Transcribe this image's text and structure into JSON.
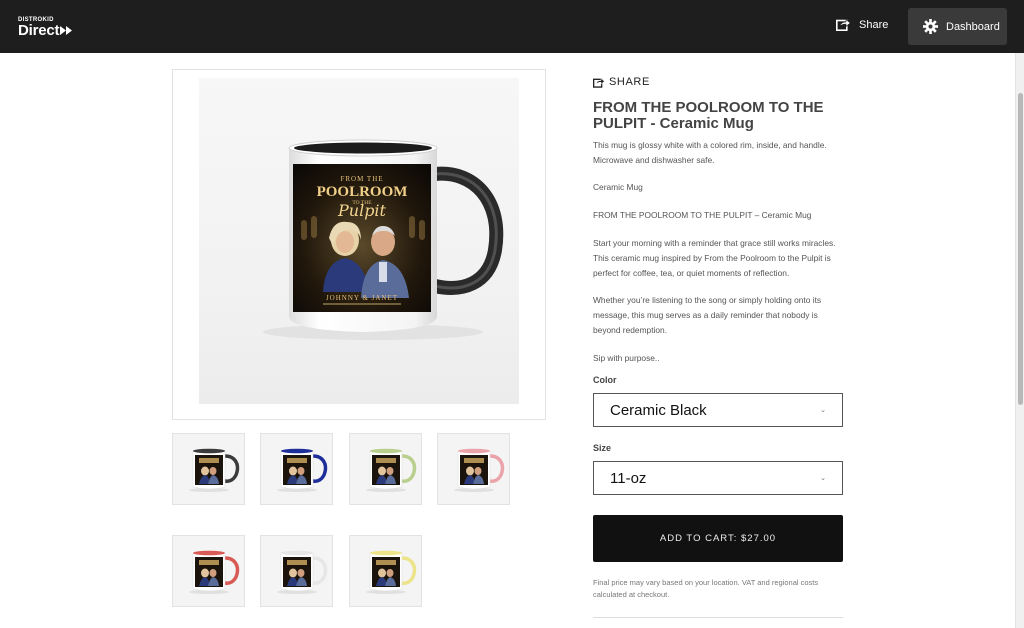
{
  "header": {
    "logo_small": "DISTROKID",
    "logo_main": "Direct",
    "share_label": "Share",
    "dashboard_label": "Dashboard"
  },
  "mug_art": {
    "line1": "FROM THE",
    "line2": "POOLROOM",
    "line3": "TO THE",
    "line4": "Pulpit",
    "artists": "JOHNNY & JANET"
  },
  "product": {
    "share_label": "SHARE",
    "title": "FROM THE POOLROOM TO THE PULPIT - Ceramic Mug",
    "paragraphs": [
      "This mug is glossy white with a colored rim, inside, and handle. Microwave and dishwasher safe.",
      "Ceramic Mug",
      "FROM THE POOLROOM TO THE PULPIT – Ceramic Mug",
      "Start your morning with a reminder that grace still works miracles. This ceramic mug inspired by From the Poolroom to the Pulpit is perfect for coffee, tea, or quiet moments of reflection.",
      "Whether you’re listening to the song or simply holding onto its message, this mug serves as a daily reminder that nobody is beyond redemption.",
      "Sip with purpose.."
    ],
    "color_label": "Color",
    "color_value": "Ceramic Black",
    "size_label": "Size",
    "size_value": "11-oz",
    "cart_label": "ADD TO CART: $27.00",
    "note": "Final price may vary based on your location. VAT and regional costs calculated at checkout."
  },
  "thumbnails": [
    {
      "name": "thumb-black",
      "color": "#3b3b3b"
    },
    {
      "name": "thumb-blue",
      "color": "#1f2f9a"
    },
    {
      "name": "thumb-green",
      "color": "#b9cf8d"
    },
    {
      "name": "thumb-pink",
      "color": "#eba3aa"
    },
    {
      "name": "thumb-red",
      "color": "#d85a54"
    },
    {
      "name": "thumb-white",
      "color": "#e6e6e6"
    },
    {
      "name": "thumb-yellow",
      "color": "#ede48a"
    }
  ],
  "colors": {
    "header_bg": "#1e1e1e",
    "cart_bg": "#111111",
    "selected_handle": "#2a2a2a"
  }
}
